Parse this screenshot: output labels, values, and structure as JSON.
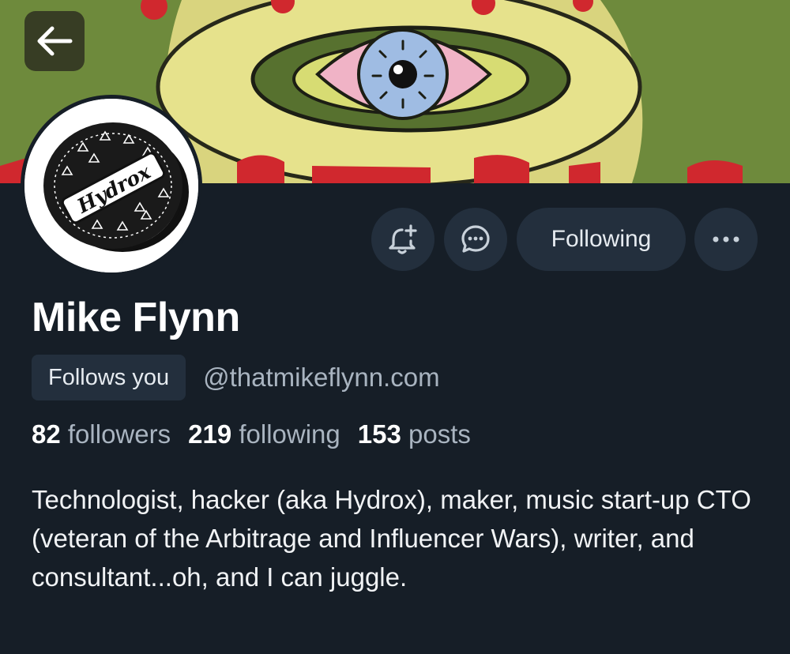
{
  "header": {
    "banner_icon": "eye-illustration",
    "back_icon": "arrow-left-icon"
  },
  "profile": {
    "avatar_icon": "hydrox-cookie-avatar",
    "avatar_text": "Hydrox",
    "display_name": "Mike Flynn",
    "follows_you_label": "Follows you",
    "handle": "@thatmikeflynn.com",
    "stats": {
      "followers_count": "82",
      "followers_label": "followers",
      "following_count": "219",
      "following_label": "following",
      "posts_count": "153",
      "posts_label": "posts"
    },
    "bio": "Technologist, hacker (aka Hydrox), maker, music start-up CTO (veteran of the Arbitrage and Influencer Wars), writer, and consultant...oh, and I can juggle."
  },
  "actions": {
    "notify_icon": "bell-plus-icon",
    "message_icon": "chat-bubble-icon",
    "following_label": "Following",
    "more_icon": "ellipsis-icon"
  },
  "colors": {
    "background": "#161e27",
    "button_bg": "#232f3d",
    "muted_text": "#a9b4c0",
    "text": "#ffffff"
  }
}
